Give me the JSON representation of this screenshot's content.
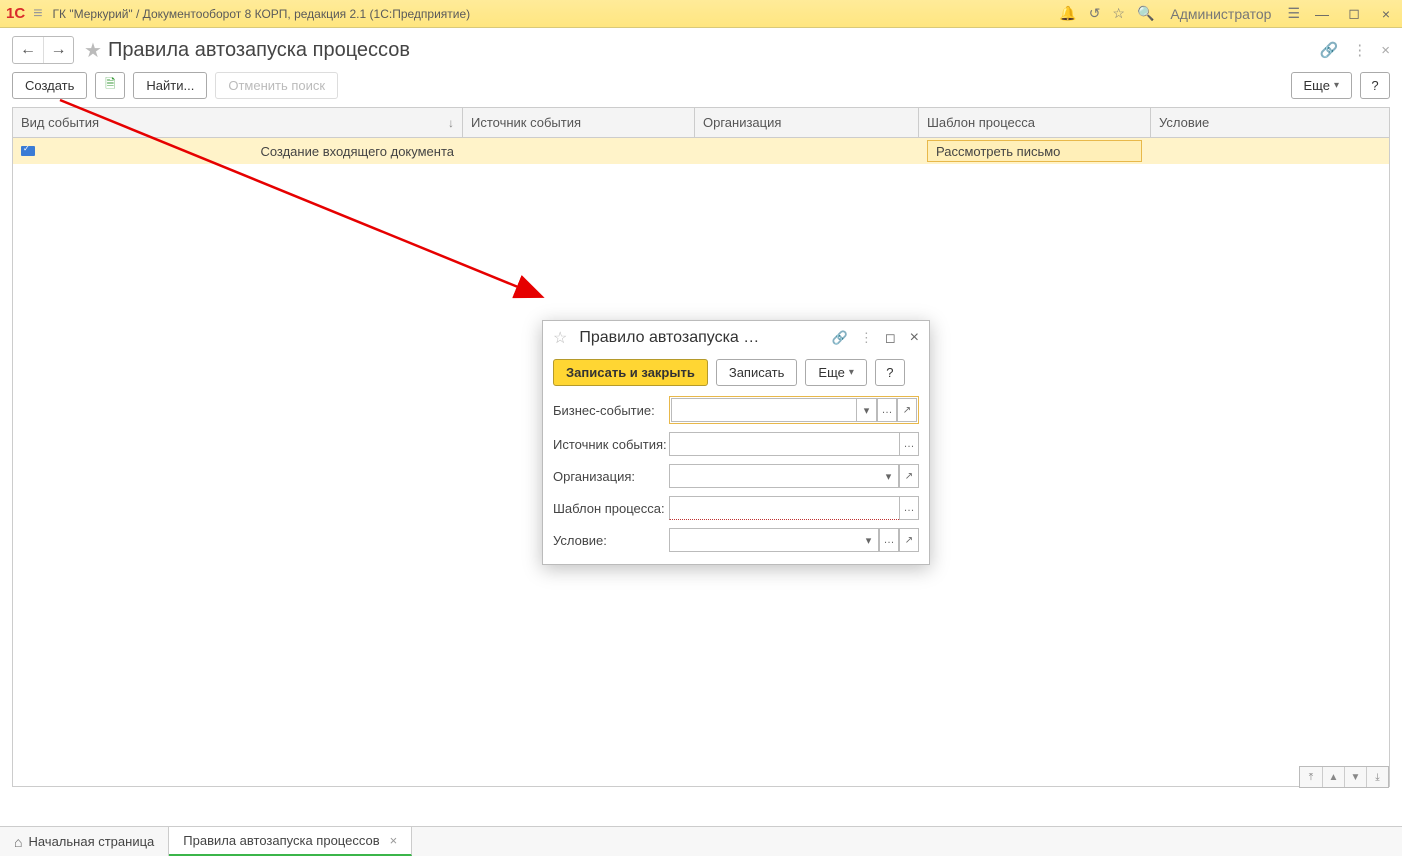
{
  "app": {
    "title": "ГК \"Меркурий\" / Документооборот 8 КОРП, редакция 2.1  (1С:Предприятие)",
    "user": "Администратор"
  },
  "page": {
    "title": "Правила автозапуска процессов"
  },
  "toolbar": {
    "create": "Создать",
    "find": "Найти...",
    "cancel_search": "Отменить поиск",
    "more": "Еще",
    "help": "?"
  },
  "grid": {
    "headers": {
      "event_type": "Вид события",
      "source": "Источник события",
      "org": "Организация",
      "template": "Шаблон процесса",
      "condition": "Условие"
    },
    "rows": [
      {
        "event_type": "Создание входящего документа",
        "source": "",
        "org": "",
        "template": "Рассмотреть письмо",
        "condition": ""
      }
    ]
  },
  "dialog": {
    "title": "Правило автозапуска …",
    "save_close": "Записать и закрыть",
    "save": "Записать",
    "more": "Еще",
    "help": "?",
    "labels": {
      "biz_event": "Бизнес-событие:",
      "source": "Источник события:",
      "org": "Организация:",
      "template": "Шаблон процесса:",
      "condition": "Условие:"
    }
  },
  "tabs": {
    "home": "Начальная страница",
    "current": "Правила автозапуска процессов"
  }
}
